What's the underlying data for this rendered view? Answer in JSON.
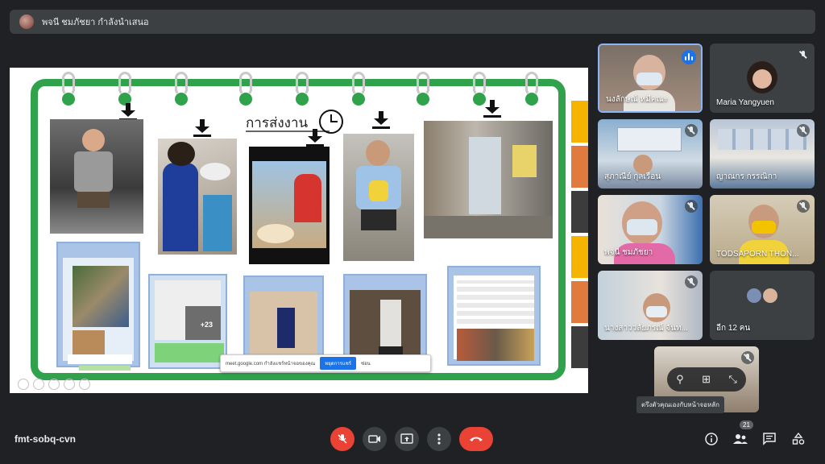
{
  "topbar": {
    "presenter_text": "พจนี ชมภัชยา กำลังนำเสนอ"
  },
  "slide": {
    "title": "การส่งงาน",
    "badge_more_photos": "+23",
    "share_bar": {
      "text": "meet.google.com กำลังแชร์หน้าจอของคุณ",
      "stop_label": "หยุดการแชร์",
      "hide_label": "ซ่อน"
    }
  },
  "participants": [
    {
      "name": "นงลักษณ์ หมีคณะ",
      "speaking": true
    },
    {
      "name": "Maria Yangyuen",
      "muted": true
    },
    {
      "name": "สุภาณีย์ กุลเรือน",
      "muted": true
    },
    {
      "name": "ญาณกร กรรณิกา",
      "muted": true
    },
    {
      "name": "พจนี ชมภัชยา",
      "muted": true
    },
    {
      "name": "TODSAPORN THON...",
      "muted": true
    },
    {
      "name": "นางสาววลัยภรณ์ จันท...",
      "muted": true
    }
  ],
  "more_tile": {
    "label": "อีก 12 คน"
  },
  "self_tile": {
    "tooltip": "ตรึงตัวคุณเองกับหน้าจอหลัก"
  },
  "bottom": {
    "meeting_code": "fmt-sobq-cvn",
    "people_count": "21"
  },
  "colors": {
    "accent": "#1a73e8",
    "danger": "#ea4335",
    "board_green": "#2fa24b"
  }
}
